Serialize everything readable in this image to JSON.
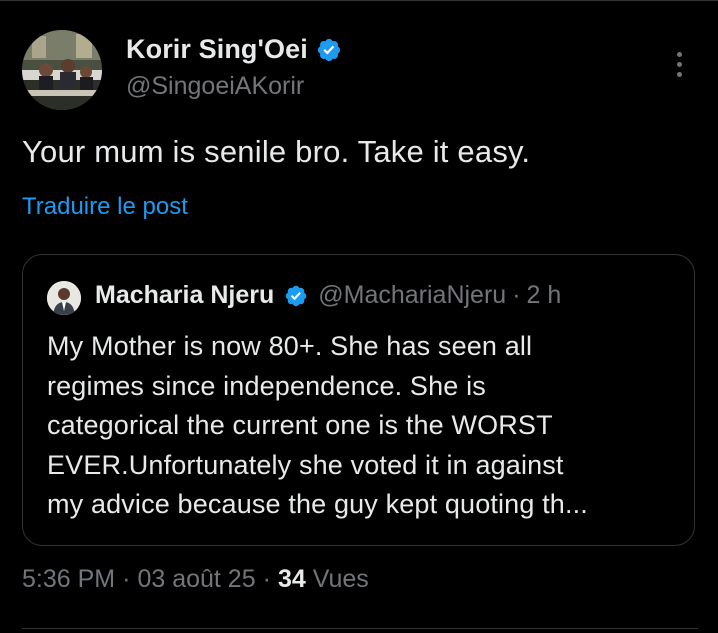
{
  "author": {
    "display_name": "Korir Sing'Oei",
    "handle": "@SingoeiAKorir"
  },
  "tweet": {
    "text": "Your mum is senile bro. Take it easy.",
    "translate_label": "Traduire le post"
  },
  "quoted": {
    "display_name": "Macharia Njeru",
    "handle": "@MachariaNjeru",
    "separator": "·",
    "time": "2 h",
    "lines": [
      "My Mother is now 80+. She has seen all",
      "regimes since independence. She is",
      "categorical the current one is the WORST",
      "EVER.Unfortunately she voted it in against",
      "my advice because the guy kept quoting th..."
    ]
  },
  "meta": {
    "time": "5:36 PM",
    "sep1": "·",
    "date": "03 août 25",
    "sep2": "·",
    "views_count": "34",
    "views_label": "Vues"
  },
  "icons": {
    "verified": "verified-badge-icon",
    "more": "more-vertical-icon"
  },
  "colors": {
    "background": "#000000",
    "text": "#e7e9ea",
    "muted": "#71767b",
    "link": "#1d9bf0",
    "verified": "#1d9bf0",
    "border": "#2f3336"
  }
}
